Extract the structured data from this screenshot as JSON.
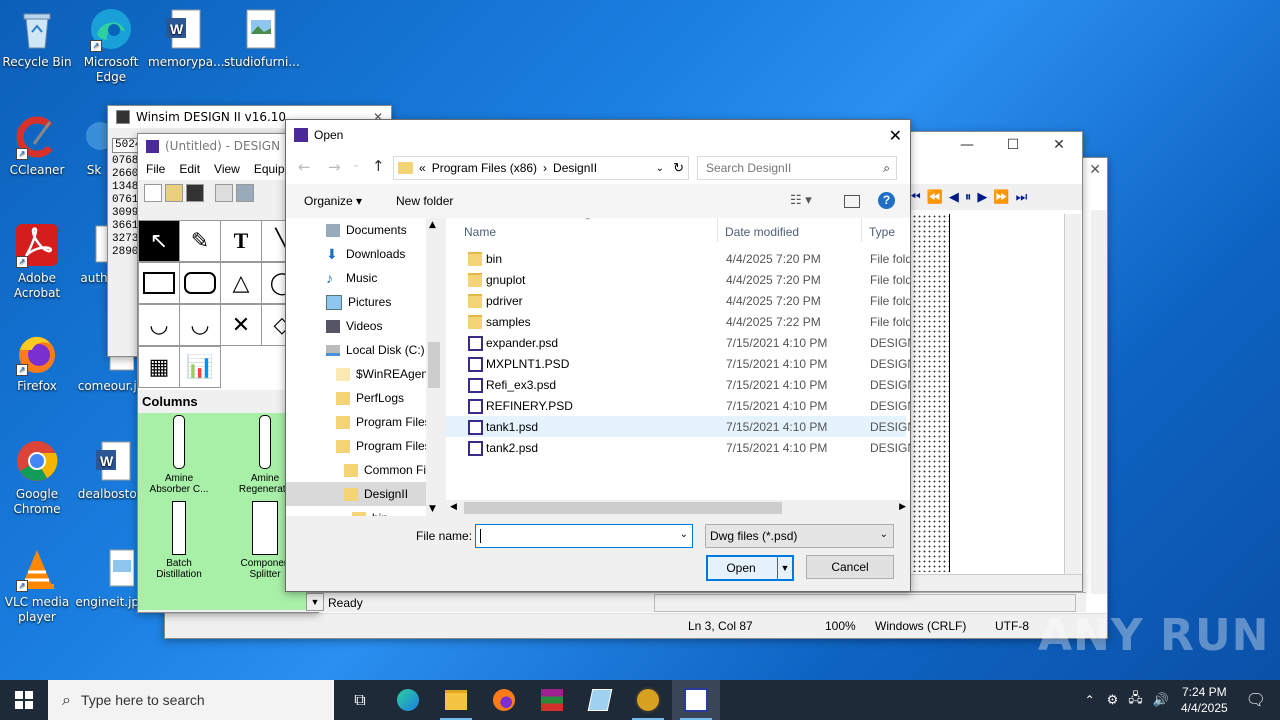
{
  "desktop": {
    "icons": [
      {
        "label": "Recycle Bin"
      },
      {
        "label": "Microsoft Edge"
      },
      {
        "label": "memorypa..."
      },
      {
        "label": "studiofurni..."
      },
      {
        "label": "CCleaner"
      },
      {
        "label": "Sk"
      },
      {
        "label": "Adobe Acrobat"
      },
      {
        "label": "auth"
      },
      {
        "label": "Firefox"
      },
      {
        "label": "comeour.jp"
      },
      {
        "label": "Google Chrome"
      },
      {
        "label": "dealboston"
      },
      {
        "label": "VLC media player"
      },
      {
        "label": "engineit.jpg"
      }
    ]
  },
  "winsim": {
    "title": "Winsim DESIGN II v16.10",
    "numbers": [
      "5024",
      "0768",
      "2660",
      "1348",
      "0761",
      "3099",
      "3661",
      "3273",
      "2890"
    ]
  },
  "design": {
    "title": "(Untitled) - DESIGN II fo",
    "menu": [
      "File",
      "Edit",
      "View",
      "Equipm"
    ],
    "palette_title": "Columns",
    "equipment": [
      "Amine Absorber C...",
      "Amine Regenerato",
      "Batch Distillation",
      "Componen Splitter"
    ],
    "status": "Ready"
  },
  "notepad": {
    "status": {
      "pos": "Ln 3, Col 87",
      "zoom": "100%",
      "eol": "Windows (CRLF)",
      "enc": "UTF-8"
    }
  },
  "dialog": {
    "title": "Open",
    "breadcrumb": [
      "«",
      "Program Files (x86)",
      "DesignII"
    ],
    "search_placeholder": "Search DesignII",
    "organize": "Organize",
    "new_folder": "New folder",
    "columns": {
      "name": "Name",
      "date": "Date modified",
      "type": "Type"
    },
    "nav": [
      "Documents",
      "Downloads",
      "Music",
      "Pictures",
      "Videos",
      "Local Disk (C:)",
      "$WinREAgent",
      "PerfLogs",
      "Program Files",
      "Program Files",
      "Common Fi",
      "DesignII",
      "bin"
    ],
    "files": [
      {
        "name": "bin",
        "date": "4/4/2025 7:20 PM",
        "type": "File fold",
        "kind": "folder"
      },
      {
        "name": "gnuplot",
        "date": "4/4/2025 7:20 PM",
        "type": "File fold",
        "kind": "folder"
      },
      {
        "name": "pdriver",
        "date": "4/4/2025 7:20 PM",
        "type": "File fold",
        "kind": "folder"
      },
      {
        "name": "samples",
        "date": "4/4/2025 7:22 PM",
        "type": "File fold",
        "kind": "folder"
      },
      {
        "name": "expander.psd",
        "date": "7/15/2021 4:10 PM",
        "type": "DESIGN",
        "kind": "psd"
      },
      {
        "name": "MXPLNT1.PSD",
        "date": "7/15/2021 4:10 PM",
        "type": "DESIGN",
        "kind": "psd"
      },
      {
        "name": "Refi_ex3.psd",
        "date": "7/15/2021 4:10 PM",
        "type": "DESIGN",
        "kind": "psd"
      },
      {
        "name": "REFINERY.PSD",
        "date": "7/15/2021 4:10 PM",
        "type": "DESIGN",
        "kind": "psd"
      },
      {
        "name": "tank1.psd",
        "date": "7/15/2021 4:10 PM",
        "type": "DESIGN",
        "kind": "psd"
      },
      {
        "name": "tank2.psd",
        "date": "7/15/2021 4:10 PM",
        "type": "DESIGN",
        "kind": "psd"
      }
    ],
    "file_name_label": "File name:",
    "file_name_value": "",
    "filter": "Dwg files (*.psd)",
    "open": "Open",
    "cancel": "Cancel"
  },
  "taskbar": {
    "search_placeholder": "Type here to search",
    "time": "7:24 PM",
    "date": "4/4/2025"
  },
  "watermark": "ANY RUN"
}
